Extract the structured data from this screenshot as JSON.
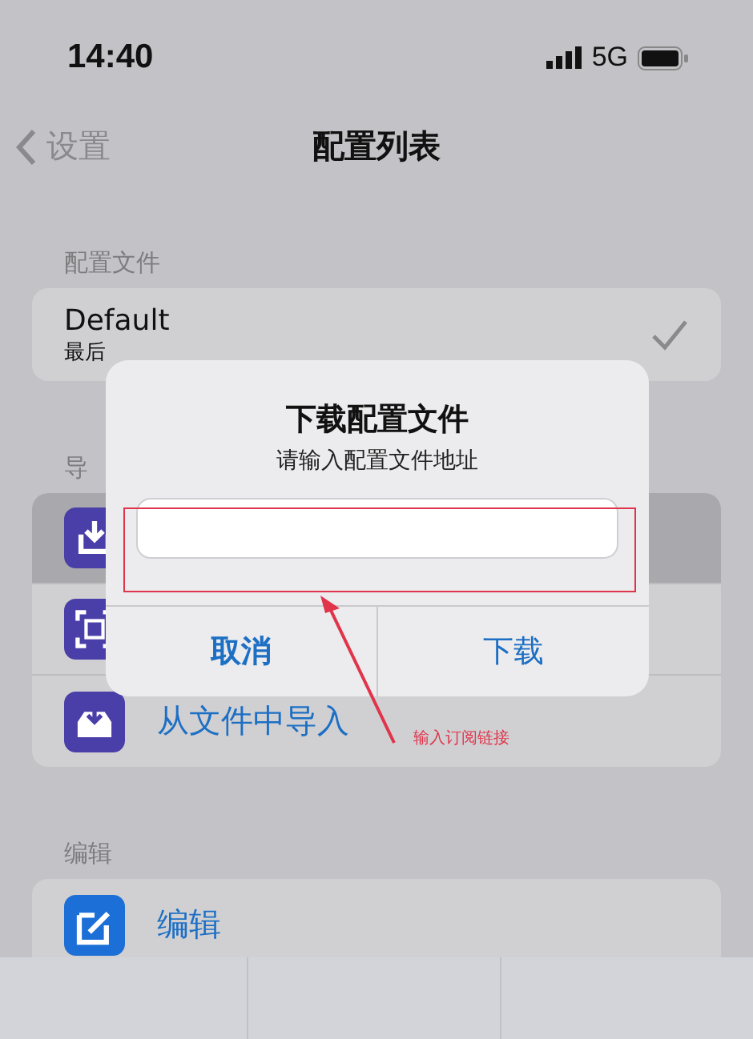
{
  "status_bar": {
    "time": "14:40",
    "network": "5G"
  },
  "nav": {
    "back": "设置",
    "title": "配置列表"
  },
  "profiles": {
    "header": "配置文件",
    "items": [
      {
        "name": "Default",
        "subtitle": "最后",
        "selected": true
      }
    ]
  },
  "import": {
    "header": "导",
    "items": [
      {
        "kind": "download",
        "selected": true
      },
      {
        "kind": "scan",
        "selected": false
      },
      {
        "kind": "file",
        "label": "从文件中导入",
        "selected": false
      }
    ]
  },
  "edit": {
    "header": "编辑",
    "items": [
      {
        "kind": "edit",
        "label": "编辑"
      }
    ]
  },
  "dialog": {
    "title": "下载配置文件",
    "message": "请输入配置文件地址",
    "buttons": [
      {
        "label": "取消",
        "bold": true
      },
      {
        "label": "下载",
        "bold": false
      }
    ]
  },
  "annotation": {
    "text": "输入订阅链接"
  }
}
